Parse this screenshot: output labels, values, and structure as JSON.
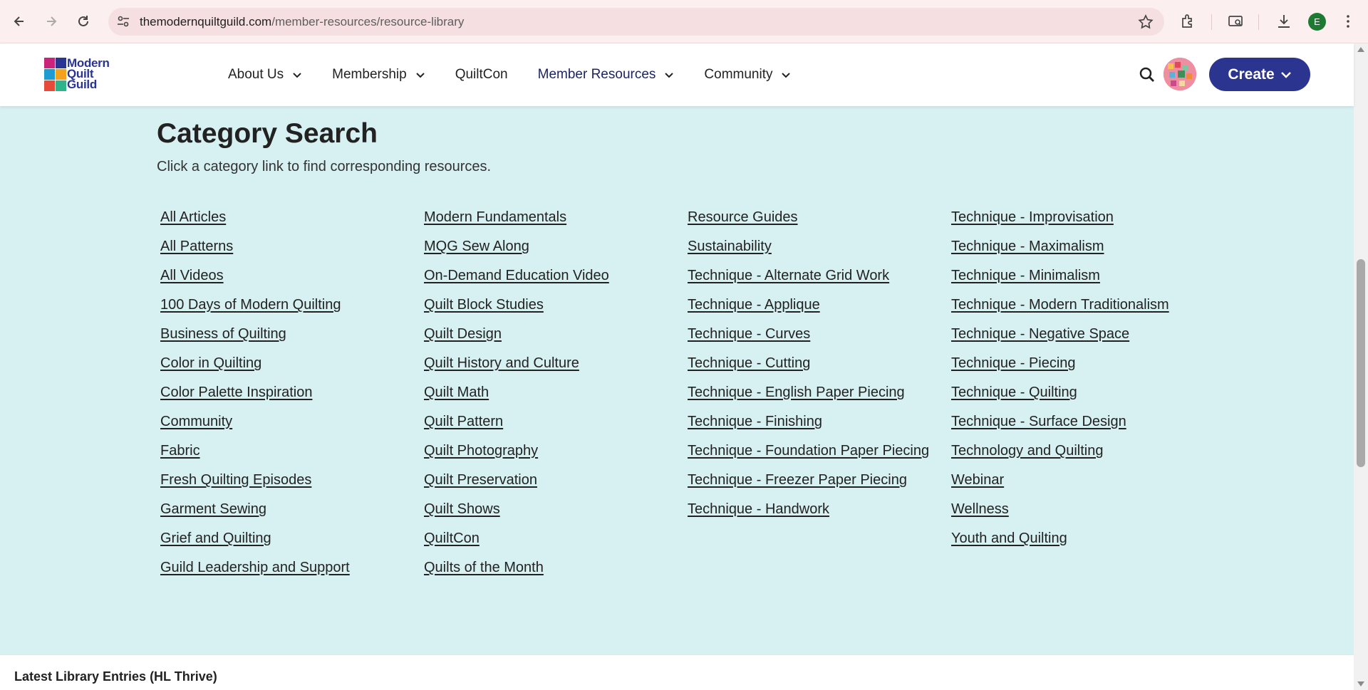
{
  "browser": {
    "url_host": "themodernquiltguild.com",
    "url_path": "/member-resources/resource-library",
    "profile_initial": "E",
    "profile_color": "#1e7a33"
  },
  "site": {
    "logo_lines": [
      "Modern",
      "Quilt",
      "Guild"
    ],
    "brand_color": "#2a3592",
    "menu": [
      {
        "label": "About Us",
        "has_dropdown": true
      },
      {
        "label": "Membership",
        "has_dropdown": true
      },
      {
        "label": "QuiltCon",
        "has_dropdown": false
      },
      {
        "label": "Member Resources",
        "has_dropdown": true
      },
      {
        "label": "Community",
        "has_dropdown": true
      }
    ],
    "create_label": "Create"
  },
  "main": {
    "title": "Category Search",
    "subtitle": "Click a category link to find corresponding resources.",
    "background": "#d7f1f2",
    "columns": [
      [
        "All Articles",
        "All Patterns",
        "All Videos",
        "100 Days of Modern Quilting",
        "Business of Quilting",
        "Color in Quilting",
        "Color Palette Inspiration",
        "Community",
        "Fabric",
        "Fresh Quilting Episodes",
        "Garment Sewing",
        "Grief and Quilting",
        "Guild Leadership and Support"
      ],
      [
        "Modern Fundamentals",
        "MQG Sew Along",
        "On-Demand Education Video",
        "Quilt Block Studies",
        "Quilt Design",
        "Quilt History and Culture",
        "Quilt Math",
        "Quilt Pattern",
        "Quilt Photography",
        "Quilt Preservation",
        "Quilt Shows",
        "QuiltCon",
        "Quilts of the Month"
      ],
      [
        "Resource Guides",
        "Sustainability",
        "Technique - Alternate Grid Work",
        "Technique - Applique",
        "Technique - Curves",
        "Technique - Cutting",
        "Technique - English Paper Piecing",
        "Technique - Finishing",
        "Technique - Foundation Paper Piecing",
        "Technique - Freezer Paper Piecing",
        "Technique - Handwork"
      ],
      [
        "Technique - Improvisation",
        "Technique - Maximalism",
        "Technique - Minimalism",
        "Technique - Modern Traditionalism",
        "Technique - Negative Space",
        "Technique - Piecing",
        "Technique - Quilting",
        "Technique - Surface Design",
        "Technology and Quilting",
        "Webinar",
        "Wellness",
        "Youth and Quilting"
      ]
    ]
  },
  "bottom": {
    "header": "Latest Library Entries (HL Thrive)"
  }
}
